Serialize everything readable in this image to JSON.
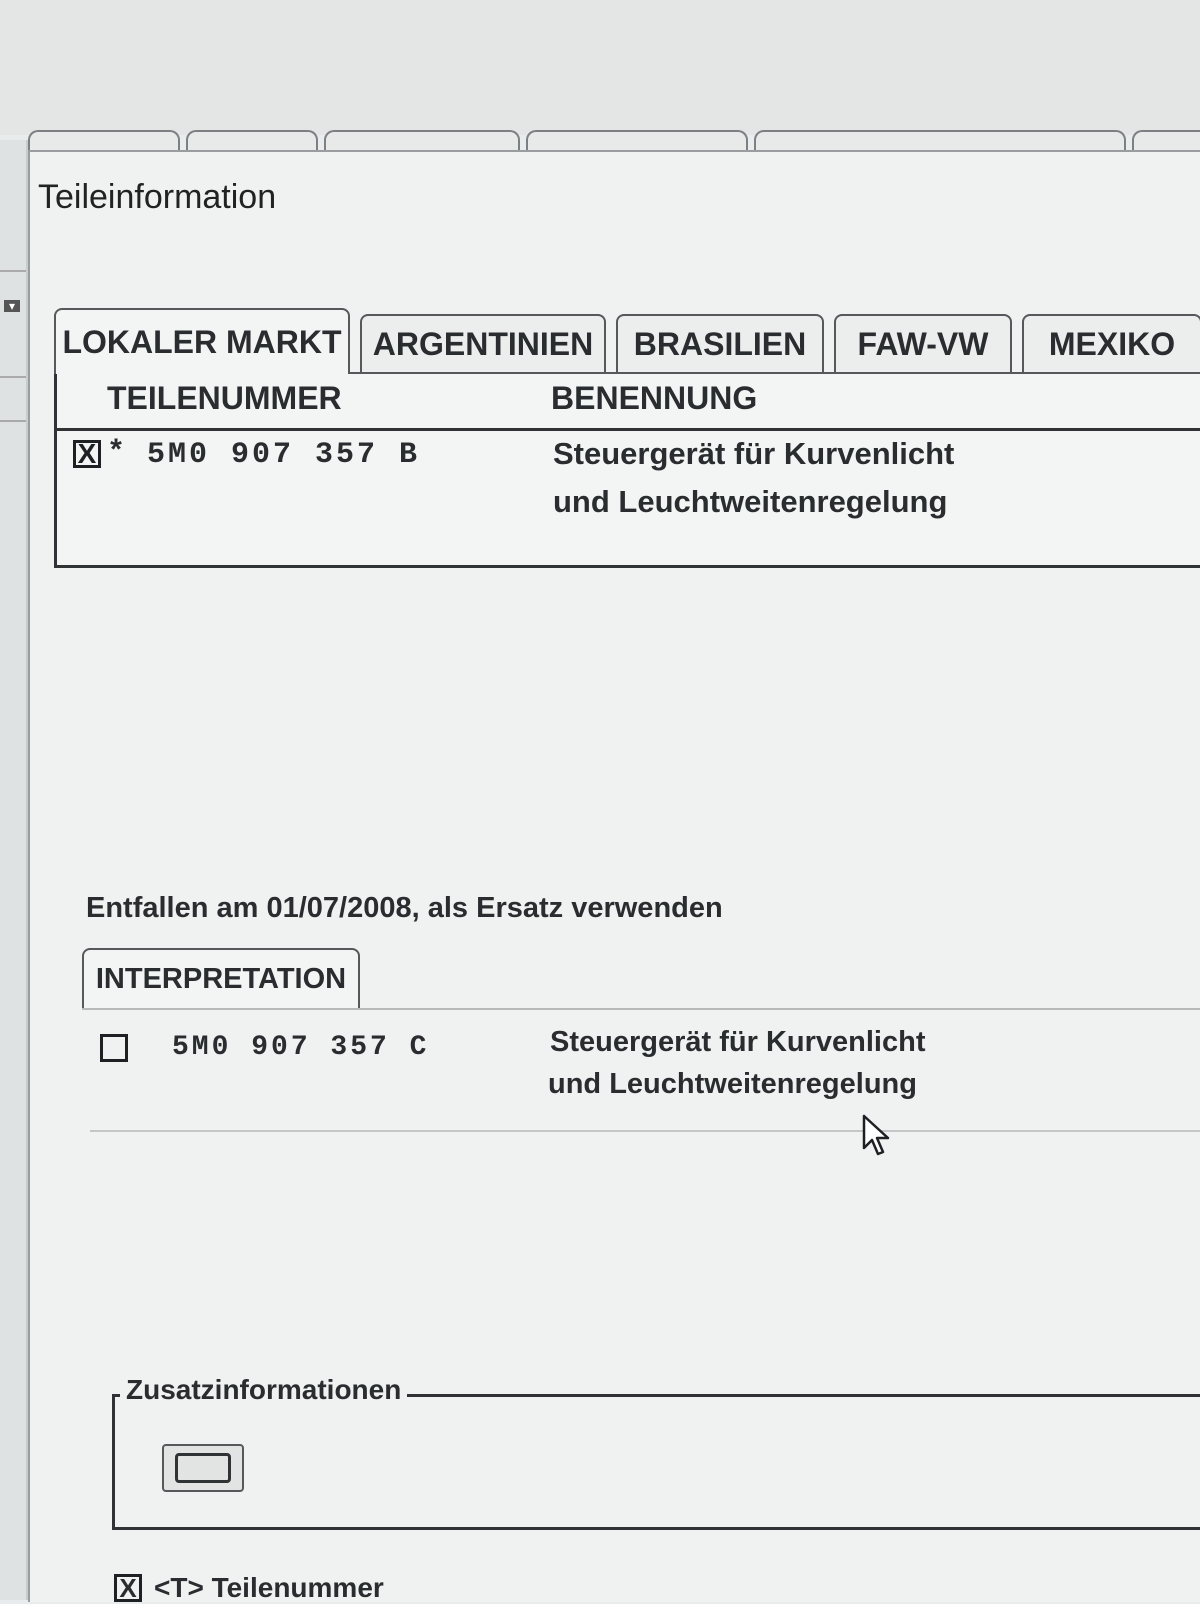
{
  "dialog": {
    "title": "Teileinformation"
  },
  "tabs": [
    {
      "label": "LOKALER MARKT",
      "active": true
    },
    {
      "label": "ARGENTINIEN",
      "active": false
    },
    {
      "label": "BRASILIEN",
      "active": false
    },
    {
      "label": "FAW-VW",
      "active": false
    },
    {
      "label": "MEXIKO",
      "active": false
    }
  ],
  "table": {
    "columns": [
      "TEILENUMMER",
      "BENENNUNG"
    ],
    "rows": [
      {
        "checked_mark": "X",
        "flag": "*",
        "part_number": "5M0 907 357 B",
        "description_line1": "Steuergerät für Kurvenlicht",
        "description_line2": "und Leuchtweitenregelung"
      }
    ]
  },
  "status_message": "Entfallen am 01/07/2008, als Ersatz verwenden",
  "interpretation": {
    "tab_label": "INTERPRETATION",
    "rows": [
      {
        "part_number": "5M0 907 357 C",
        "description_line1": "Steuergerät für Kurvenlicht",
        "description_line2": "und Leuchtweitenregelung"
      }
    ]
  },
  "additional_info": {
    "legend": "Zusatzinformationen"
  },
  "bottom_option": {
    "checked_mark": "X",
    "label": "<T> Teilenummer"
  }
}
